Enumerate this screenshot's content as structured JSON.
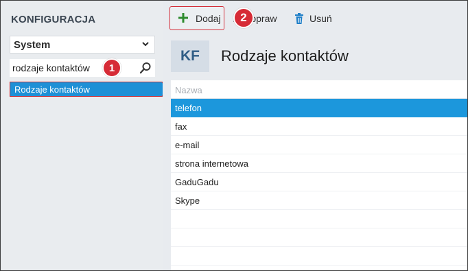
{
  "sidebar": {
    "title": "KONFIGURACJA",
    "select_value": "System",
    "search_value": "rodzaje kontaktów",
    "result_label": "Rodzaje kontaktów"
  },
  "toolbar": {
    "add_label": "Dodaj",
    "edit_label": "Popraw",
    "delete_label": "Usuń"
  },
  "header": {
    "badge": "KF",
    "title": "Rodzaje kontaktów"
  },
  "list": {
    "column": "Nazwa",
    "rows": [
      "telefon",
      "fax",
      "e-mail",
      "strona internetowa",
      "GaduGadu",
      "Skype"
    ],
    "selected_index": 0
  },
  "annotations": {
    "step1": "1",
    "step2": "2"
  },
  "colors": {
    "accent_blue": "#1c97dc",
    "annotation_red": "#d62b36",
    "add_green": "#2e8b2e",
    "delete_blue": "#1f7fc8"
  },
  "icons": {
    "select": "chevron-down-icon",
    "search": "search-icon",
    "add": "plus-icon",
    "edit": "pencil-icon",
    "delete": "trash-icon"
  }
}
